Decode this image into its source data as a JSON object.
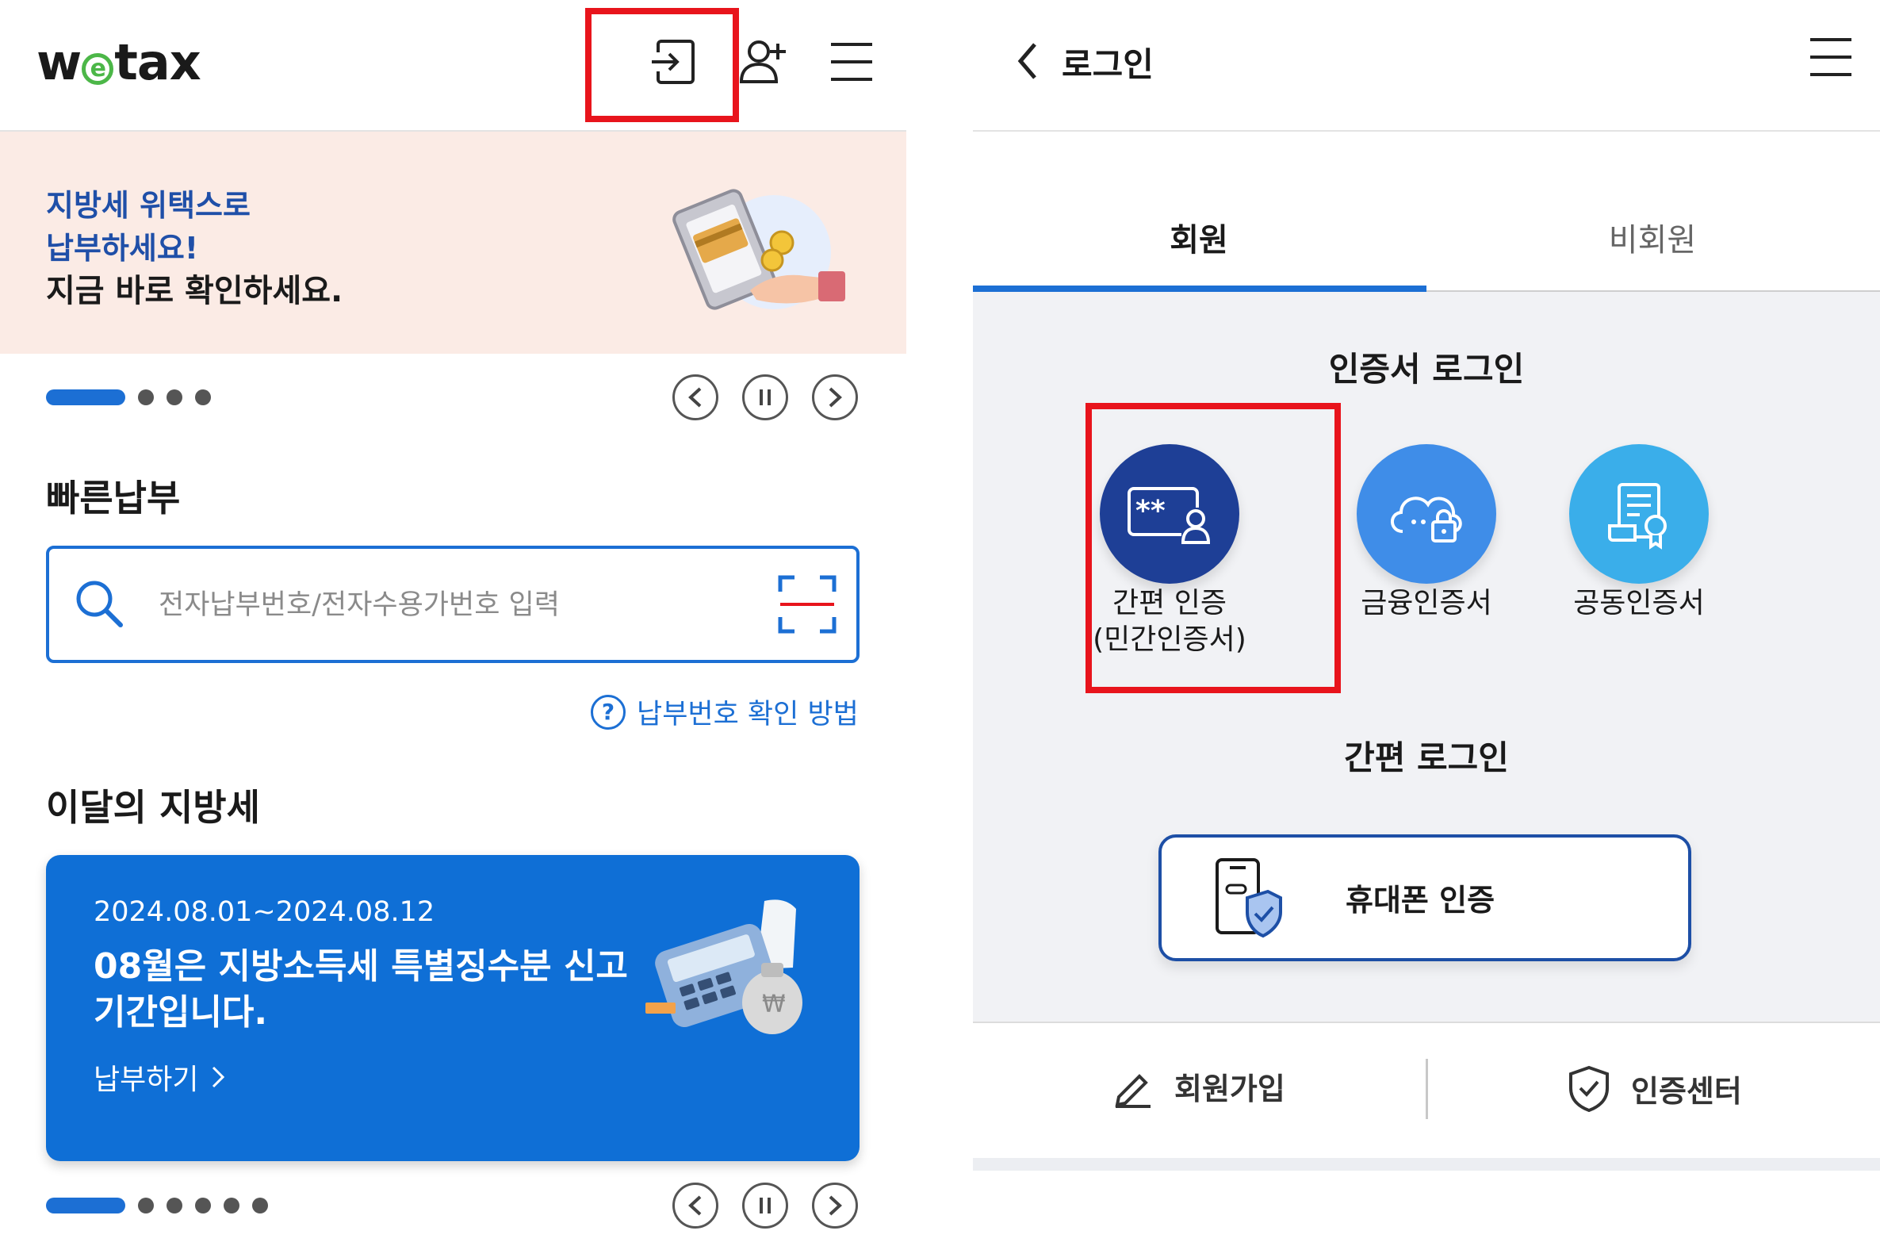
{
  "left": {
    "logo": {
      "pre": "w",
      "e": "e",
      "post": "tax"
    },
    "banner": {
      "line1": "지방세 위택스로",
      "line2": "납부하세요!",
      "line3": "지금 바로 확인하세요."
    },
    "quick_pay": {
      "title": "빠른납부",
      "placeholder": "전자납부번호/전자수용가번호 입력",
      "help_icon": "?",
      "help_link": "납부번호 확인 방법"
    },
    "monthly": {
      "title": "이달의 지방세",
      "card": {
        "date": "2024.08.01~2024.08.12",
        "line1": "08월은 지방소득세 특별징수분 신고",
        "line2": "기간입니다.",
        "link": "납부하기",
        "won_symbol": "₩"
      }
    },
    "banner_pager": {
      "active": 1,
      "total": 4
    },
    "card_pager": {
      "active": 1,
      "total": 6
    }
  },
  "right": {
    "title": "로그인",
    "tabs": [
      {
        "label": "회원",
        "active": true
      },
      {
        "label": "비회원",
        "active": false
      }
    ],
    "cert_section_title": "인증서 로그인",
    "certs": [
      {
        "label_line1": "간편 인증",
        "label_line2": "(민간인증서)",
        "color": "#1e3f96",
        "icon": "simple-auth-icon"
      },
      {
        "label_line1": "금융인증서",
        "label_line2": "",
        "color": "#3f8de8",
        "icon": "cloud-lock-icon"
      },
      {
        "label_line1": "공동인증서",
        "label_line2": "",
        "color": "#3aaeea",
        "icon": "certificate-doc-icon"
      }
    ],
    "simple_section_title": "간편 로그인",
    "phone_auth": "휴대폰 인증",
    "footer": {
      "signup": "회원가입",
      "cert_center": "인증센터"
    }
  },
  "colors": {
    "accent": "#1c6fd4",
    "highlight": "#e8141c",
    "banner_bg": "#fbebe5",
    "card_bg": "#0f6fd6"
  }
}
